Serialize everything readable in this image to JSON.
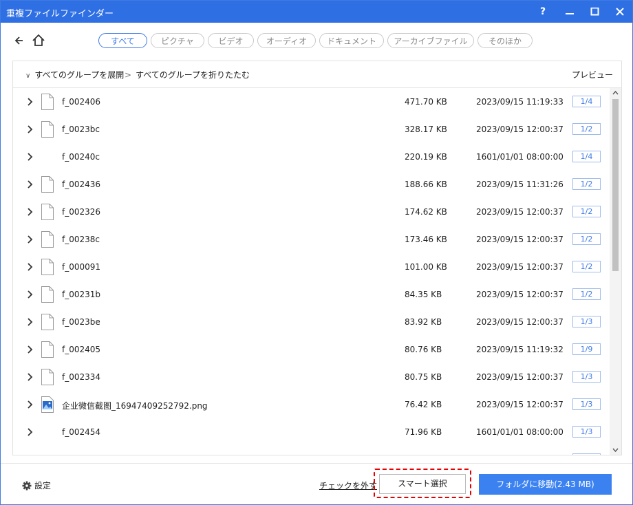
{
  "window": {
    "title": "重複ファイルファインダー",
    "help": "?"
  },
  "filters": [
    {
      "label": "すべて",
      "active": true
    },
    {
      "label": "ピクチャ",
      "active": false
    },
    {
      "label": "ビデオ",
      "active": false
    },
    {
      "label": "オーディオ",
      "active": false
    },
    {
      "label": "ドキュメント",
      "active": false
    },
    {
      "label": "アーカイブファイル",
      "active": false
    },
    {
      "label": "そのほか",
      "active": false
    }
  ],
  "list_header": {
    "expand_all": "すべてのグループを展開",
    "collapse_all": "すべてのグループを折りたたむ",
    "preview": "プレビュー"
  },
  "rows": [
    {
      "name": "f_002406",
      "size": "471.70 KB",
      "date": "2023/09/15 11:19:33",
      "group": "1/4",
      "icon": "file-icon"
    },
    {
      "name": "f_0023bc",
      "size": "328.17 KB",
      "date": "2023/09/15 12:00:37",
      "group": "1/2",
      "icon": "file-icon"
    },
    {
      "name": "f_00240c",
      "size": "220.19 KB",
      "date": "1601/01/01 08:00:00",
      "group": "1/4",
      "icon": "none"
    },
    {
      "name": "f_002436",
      "size": "188.66 KB",
      "date": "2023/09/15 11:31:26",
      "group": "1/2",
      "icon": "file-icon"
    },
    {
      "name": "f_002326",
      "size": "174.62 KB",
      "date": "2023/09/15 12:00:37",
      "group": "1/2",
      "icon": "file-icon"
    },
    {
      "name": "f_00238c",
      "size": "173.46 KB",
      "date": "2023/09/15 12:00:37",
      "group": "1/2",
      "icon": "file-icon"
    },
    {
      "name": "f_000091",
      "size": "101.00 KB",
      "date": "2023/09/15 12:00:37",
      "group": "1/2",
      "icon": "file-icon"
    },
    {
      "name": "f_00231b",
      "size": "84.35 KB",
      "date": "2023/09/15 12:00:37",
      "group": "1/2",
      "icon": "file-icon"
    },
    {
      "name": "f_0023be",
      "size": "83.92 KB",
      "date": "2023/09/15 12:00:37",
      "group": "1/3",
      "icon": "file-icon"
    },
    {
      "name": "f_002405",
      "size": "80.76 KB",
      "date": "2023/09/15 11:19:32",
      "group": "1/9",
      "icon": "file-icon"
    },
    {
      "name": "f_002334",
      "size": "80.75 KB",
      "date": "2023/09/15 12:00:37",
      "group": "1/3",
      "icon": "file-icon"
    },
    {
      "name": "企业微信截图_16947409252792.png",
      "size": "76.42 KB",
      "date": "2023/09/15 12:00:37",
      "group": "1/3",
      "icon": "image-icon"
    },
    {
      "name": "f_002454",
      "size": "71.96 KB",
      "date": "1601/01/01 08:00:00",
      "group": "1/3",
      "icon": "none"
    }
  ],
  "footer": {
    "settings": "設定",
    "uncheck": "チェックを外す",
    "smart_select": "スマート選択",
    "move_to_folder": "フォルダに移動(2.43 MB)"
  },
  "colors": {
    "titlebar": "#2f6fe4",
    "accent": "#3b78e7",
    "primary_button": "#3b82f0",
    "highlight_outline": "#e60000"
  }
}
